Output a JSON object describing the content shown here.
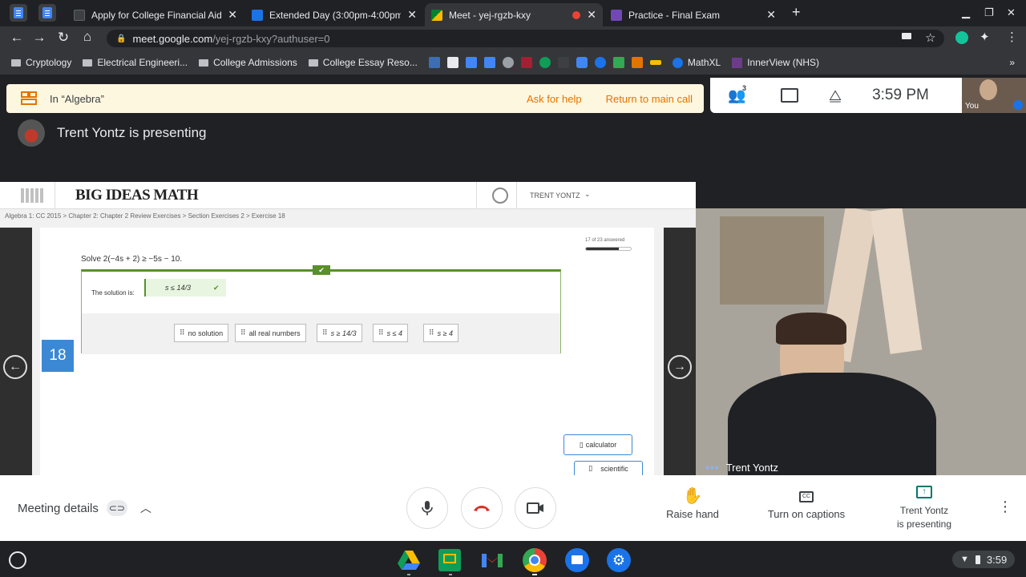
{
  "tabs": [
    {
      "title": "Apply for College Financial Aid -",
      "favicon": "shield-icon",
      "color": "#5f6368"
    },
    {
      "title": "Extended Day (3:00pm-4:00pm)",
      "favicon": "classroom-icon",
      "color": "#1a73e8"
    },
    {
      "title": "Meet - yej-rgzb-kxy",
      "favicon": "meet-icon",
      "color": "#00832d",
      "active": true,
      "recording": true
    },
    {
      "title": "Practice - Final Exam",
      "favicon": "forms-icon",
      "color": "#7248b9"
    }
  ],
  "address": {
    "host": "meet.google.com",
    "path": "/yej-rgzb-kxy?authuser=0"
  },
  "bookmarks": [
    "Cryptology",
    "Electrical Engineeri...",
    "College Admissions",
    "College Essay Reso...",
    "MathXL",
    "InnerView (NHS)"
  ],
  "bookmarks_more": "»",
  "breakout": {
    "room": "In “Algebra”",
    "help": "Ask for help",
    "return": "Return to main call"
  },
  "info": {
    "people_count": "3",
    "time": "3:59 PM",
    "you_label": "You"
  },
  "presenting_banner": "Trent Yontz is presenting",
  "screen": {
    "logo": "BIG IDEAS MATH",
    "user": "TRENT YONTZ",
    "breadcrumb": "Algebra 1: CC 2015 > Chapter 2: Chapter 2 Review Exercises > Section Exercises 2 > Exercise 18",
    "progress_text": "17 of 23 answered",
    "progress": 0.74,
    "problem": "Solve 2(−4s + 2) ≥ −5s − 10.",
    "solution_label": "The solution is:",
    "answer": "s ≤ 14/3",
    "choices": [
      "no solution",
      "all real numbers",
      "s ≥ 14/3",
      "s ≤ 4",
      "s ≥ 4"
    ],
    "exercise_number": "18",
    "calculator": "calculator",
    "scientific": "scientific"
  },
  "camera": {
    "name": "Trent Yontz"
  },
  "controls": {
    "meeting_details": "Meeting details",
    "raise_hand": "Raise hand",
    "captions": "Turn on captions",
    "presenting_line1": "Trent Yontz",
    "presenting_line2": "is presenting"
  },
  "shelf": {
    "time": "3:59"
  }
}
